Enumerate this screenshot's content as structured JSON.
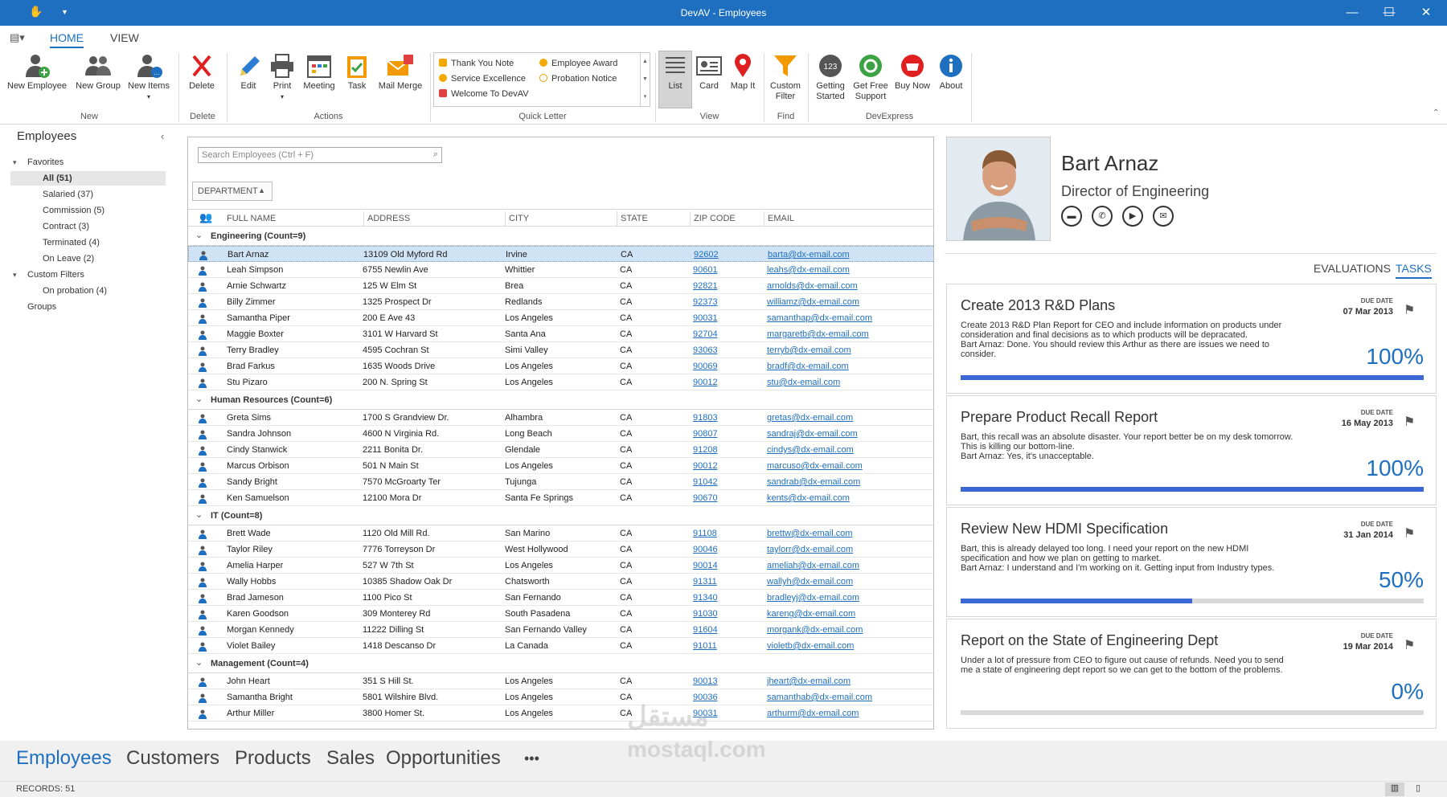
{
  "window": {
    "title": "DevAV - Employees"
  },
  "ribbon_tabs": [
    "HOME",
    "VIEW"
  ],
  "ribbon": {
    "new_employee": "New Employee",
    "new_group": "New Group",
    "new_items": "New Items",
    "grp_new": "New",
    "delete": "Delete",
    "grp_delete": "Delete",
    "edit": "Edit",
    "print": "Print",
    "meeting": "Meeting",
    "task": "Task",
    "mail_merge": "Mail Merge",
    "grp_actions": "Actions",
    "quick_letter": [
      "Thank You Note",
      "Service Excellence",
      "Welcome To DevAV",
      "Employee Award",
      "Probation Notice"
    ],
    "grp_quick_letter": "Quick Letter",
    "list": "List",
    "card": "Card",
    "map_it": "Map It",
    "grp_view": "View",
    "custom_filter_1": "Custom",
    "custom_filter_2": "Filter",
    "grp_find": "Find",
    "getting_started_1": "Getting",
    "getting_started_2": "Started",
    "free_support_1": "Get Free",
    "free_support_2": "Support",
    "buy_now": "Buy Now",
    "about": "About",
    "grp_devexpress": "DevExpress",
    "icon_123": "123"
  },
  "nav": {
    "header": "Employees",
    "favorites": "Favorites",
    "items": [
      "All (51)",
      "Salaried (37)",
      "Commission (5)",
      "Contract (3)",
      "Terminated (4)",
      "On Leave (2)"
    ],
    "custom_filters": "Custom Filters",
    "cf_items": [
      "On probation  (4)"
    ],
    "groups": "Groups"
  },
  "grid": {
    "search_placeholder": "Search Employees (Ctrl + F)",
    "group_by": "DEPARTMENT",
    "columns": [
      "FULL NAME",
      "ADDRESS",
      "CITY",
      "STATE",
      "ZIP CODE",
      "EMAIL"
    ],
    "groups": [
      {
        "title": "Engineering (Count=9)",
        "rows": [
          [
            "Bart Arnaz",
            "13109 Old Myford Rd",
            "Irvine",
            "CA",
            "92602",
            "barta@dx-email.com"
          ],
          [
            "Leah Simpson",
            "6755 Newlin Ave",
            "Whittier",
            "CA",
            "90601",
            "leahs@dx-email.com"
          ],
          [
            "Arnie Schwartz",
            "125 W Elm St",
            "Brea",
            "CA",
            "92821",
            "arnolds@dx-email.com"
          ],
          [
            "Billy Zimmer",
            "1325 Prospect Dr",
            "Redlands",
            "CA",
            "92373",
            "williamz@dx-email.com"
          ],
          [
            "Samantha Piper",
            "200 E Ave 43",
            "Los Angeles",
            "CA",
            "90031",
            "samanthap@dx-email.com"
          ],
          [
            "Maggie Boxter",
            "3101 W Harvard St",
            "Santa Ana",
            "CA",
            "92704",
            "margaretb@dx-email.com"
          ],
          [
            "Terry Bradley",
            "4595 Cochran St",
            "Simi Valley",
            "CA",
            "93063",
            "terryb@dx-email.com"
          ],
          [
            "Brad Farkus",
            "1635 Woods Drive",
            "Los Angeles",
            "CA",
            "90069",
            "bradf@dx-email.com"
          ],
          [
            "Stu Pizaro",
            "200 N. Spring St",
            "Los Angeles",
            "CA",
            "90012",
            "stu@dx-email.com"
          ]
        ]
      },
      {
        "title": "Human Resources (Count=6)",
        "rows": [
          [
            "Greta Sims",
            "1700 S Grandview Dr.",
            "Alhambra",
            "CA",
            "91803",
            "gretas@dx-email.com"
          ],
          [
            "Sandra Johnson",
            "4600 N Virginia Rd.",
            "Long Beach",
            "CA",
            "90807",
            "sandraj@dx-email.com"
          ],
          [
            "Cindy Stanwick",
            "2211 Bonita Dr.",
            "Glendale",
            "CA",
            "91208",
            "cindys@dx-email.com"
          ],
          [
            "Marcus Orbison",
            "501 N Main St",
            "Los Angeles",
            "CA",
            "90012",
            "marcuso@dx-email.com"
          ],
          [
            "Sandy Bright",
            "7570 McGroarty Ter",
            "Tujunga",
            "CA",
            "91042",
            "sandrab@dx-email.com"
          ],
          [
            "Ken Samuelson",
            "12100 Mora Dr",
            "Santa Fe Springs",
            "CA",
            "90670",
            "kents@dx-email.com"
          ]
        ]
      },
      {
        "title": "IT (Count=8)",
        "rows": [
          [
            "Brett Wade",
            "1120 Old Mill Rd.",
            "San Marino",
            "CA",
            "91108",
            "brettw@dx-email.com"
          ],
          [
            "Taylor Riley",
            "7776 Torreyson Dr",
            "West Hollywood",
            "CA",
            "90046",
            "taylorr@dx-email.com"
          ],
          [
            "Amelia Harper",
            "527 W 7th St",
            "Los Angeles",
            "CA",
            "90014",
            "ameliah@dx-email.com"
          ],
          [
            "Wally Hobbs",
            "10385 Shadow Oak Dr",
            "Chatsworth",
            "CA",
            "91311",
            "wallyh@dx-email.com"
          ],
          [
            "Brad Jameson",
            "1100 Pico St",
            "San Fernando",
            "CA",
            "91340",
            "bradleyj@dx-email.com"
          ],
          [
            "Karen Goodson",
            "309 Monterey Rd",
            "South Pasadena",
            "CA",
            "91030",
            "kareng@dx-email.com"
          ],
          [
            "Morgan Kennedy",
            "11222 Dilling St",
            "San Fernando Valley",
            "CA",
            "91604",
            "morgank@dx-email.com"
          ],
          [
            "Violet Bailey",
            "1418 Descanso Dr",
            "La Canada",
            "CA",
            "91011",
            "violetb@dx-email.com"
          ]
        ]
      },
      {
        "title": "Management (Count=4)",
        "rows": [
          [
            "John Heart",
            "351 S Hill St.",
            "Los Angeles",
            "CA",
            "90013",
            "jheart@dx-email.com"
          ],
          [
            "Samantha Bright",
            "5801 Wilshire Blvd.",
            "Los Angeles",
            "CA",
            "90036",
            "samanthab@dx-email.com"
          ],
          [
            "Arthur Miller",
            "3800 Homer St.",
            "Los Angeles",
            "CA",
            "90031",
            "arthurm@dx-email.com"
          ]
        ]
      }
    ]
  },
  "detail": {
    "name": "Bart Arnaz",
    "title": "Director of Engineering",
    "tabs": [
      "EVALUATIONS",
      "TASKS"
    ],
    "tasks": [
      {
        "title": "Create 2013 R&D Plans",
        "desc": "Create 2013 R&D Plan Report for CEO and include information on products under consideration and final decisions as to which products will be depracated.",
        "comment": "Bart Arnaz: Done. You should review this Arthur as there are issues we need to consider.",
        "due_label": "DUE DATE",
        "due": "07 Mar 2013",
        "pct": "100%",
        "progress": 1.0
      },
      {
        "title": "Prepare Product Recall Report",
        "desc": "Bart, this recall was an absolute disaster. Your report better be on my desk tomorrow. This is killing our bottom-line.",
        "comment": "Bart Arnaz: Yes, it's unacceptable.",
        "due_label": "DUE DATE",
        "due": "16 May 2013",
        "pct": "100%",
        "progress": 1.0
      },
      {
        "title": "Review New HDMI Specification",
        "desc": "Bart, this is already delayed too long. I need your report on the new HDMI specification and how we plan on getting to market.",
        "comment": "Bart Arnaz: I understand and I'm working on it. Getting input from Industry types.",
        "due_label": "DUE DATE",
        "due": "31 Jan 2014",
        "pct": "50%",
        "progress": 0.5
      },
      {
        "title": "Report on the State of Engineering Dept",
        "desc": "Under a lot of pressure from CEO to figure out cause of refunds. Need you to send me a state of engineering dept report so we can get to the bottom of the problems.",
        "comment": "",
        "due_label": "DUE DATE",
        "due": "19 Mar 2014",
        "pct": "0%",
        "progress": 0.0
      }
    ]
  },
  "modules": [
    "Employees",
    "Customers",
    "Products",
    "Sales",
    "Opportunities",
    "•••"
  ],
  "status": {
    "records": "RECORDS: 51"
  },
  "watermark": {
    "logo": "مستقل",
    "url": "mostaql.com"
  },
  "colors": {
    "accent": "#1e6fc0",
    "progress": "#3a66d6"
  }
}
